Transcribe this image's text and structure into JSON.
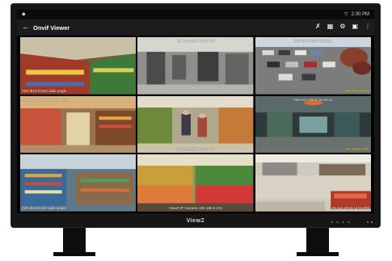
{
  "statusbar": {
    "time": "2:30 PM"
  },
  "appbar": {
    "title": "Onvif Viewer"
  },
  "icons": {
    "back": "back-arrow-icon",
    "fullscreen": "fullscreen-icon",
    "grid": "grid-layout-icon",
    "settings": "gear-icon",
    "snapshot": "camera-icon",
    "more": "more-vertical-icon"
  },
  "cameras": [
    {
      "top": "",
      "top_center": "",
      "bottom": "ADCi810-D10G wide angle",
      "bottom_pos": "bl",
      "color": "#ffffff"
    },
    {
      "top": "",
      "top_center": "26 Jun 2016 14:23 PM",
      "bottom": "",
      "bottom_pos": "bl",
      "color": "#ffffff"
    },
    {
      "top": "",
      "top_center": "26N 3CA Wed 16:25:11",
      "bottom": "ADCi8D5-F312",
      "bottom_pos": "br",
      "color": "#f4e23a"
    },
    {
      "top": "ViewZ IP Camera 192.168.0.1",
      "top_center": "",
      "bottom": "",
      "bottom_pos": "bl",
      "color": "#ffffff"
    },
    {
      "top": "",
      "top_center": "",
      "bottom": "26 Jun 2016 14:23 PM",
      "bottom_pos": "bc",
      "color": "#ffffff"
    },
    {
      "top": "",
      "top_center": "28N 3CA Wed 16:25:11",
      "bottom": "ADCi8D5-F300",
      "bottom_pos": "br",
      "color": "#f4e23a"
    },
    {
      "top": "",
      "top_center": "",
      "bottom": "ADCi610-D323 wide angle",
      "bottom_pos": "bl",
      "color": "#ffffff"
    },
    {
      "top": "",
      "top_center": "",
      "bottom": "ViewZ IP Camera 192.168.0.101",
      "bottom_pos": "bc",
      "color": "#ffffff"
    },
    {
      "top": "",
      "top_center": "",
      "bottom": "26 Jun 2016 14:23 PM",
      "bottom_pos": "br",
      "color": "#ffffff"
    }
  ],
  "brand": "ViewZ"
}
